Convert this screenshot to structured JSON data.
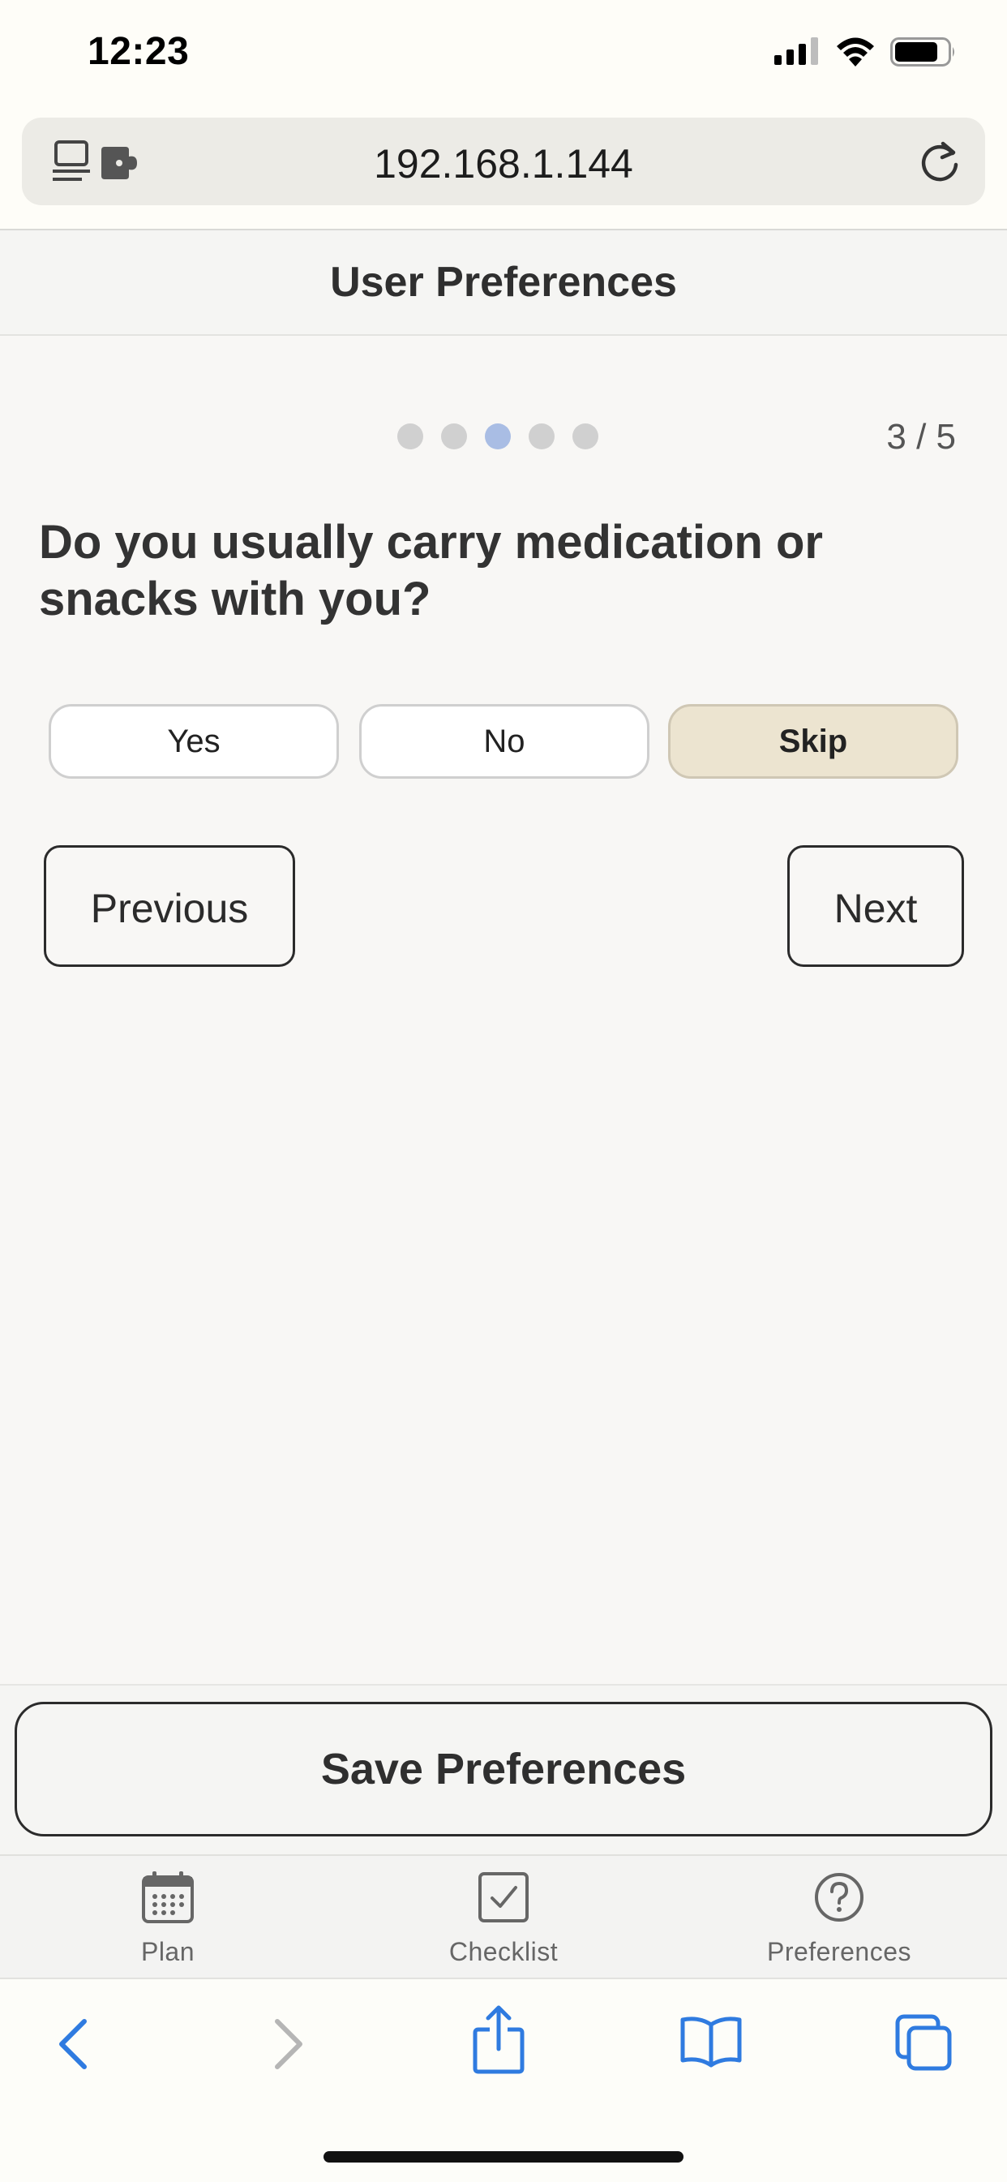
{
  "status_bar": {
    "time": "12:23"
  },
  "browser": {
    "url": "192.168.1.144"
  },
  "header": {
    "title": "User Preferences"
  },
  "wizard": {
    "current_step": 3,
    "total_steps": 5,
    "step_counter": "3 / 5",
    "question": "Do you usually carry medication or snacks with you?",
    "options": [
      {
        "label": "Yes",
        "selected": false
      },
      {
        "label": "No",
        "selected": false
      },
      {
        "label": "Skip",
        "selected": true
      }
    ],
    "previous_label": "Previous",
    "next_label": "Next"
  },
  "save": {
    "label": "Save Preferences"
  },
  "app_tabs": [
    {
      "label": "Plan",
      "icon": "calendar-icon"
    },
    {
      "label": "Checklist",
      "icon": "checkbox-icon"
    },
    {
      "label": "Preferences",
      "icon": "question-circle-icon"
    }
  ],
  "colors": {
    "active_dot": "#a9bde4",
    "inactive_dot": "#d0d0d0",
    "selected_option": "#ece4d0",
    "safari_accent": "#2f7be0"
  }
}
